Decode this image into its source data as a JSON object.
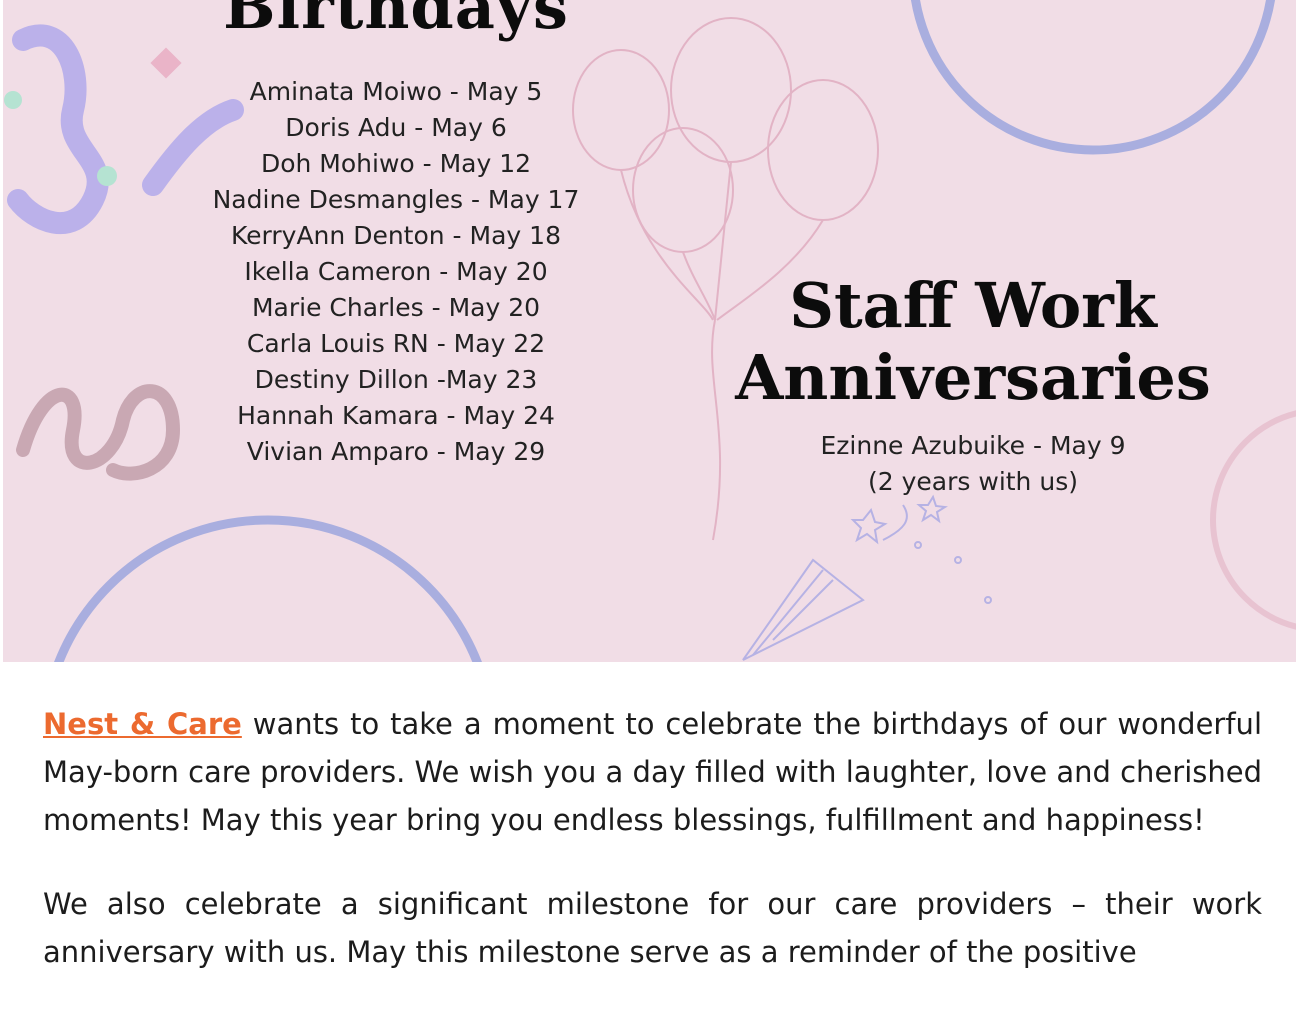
{
  "birthdays": {
    "title": "Birthdays",
    "entries": [
      "Aminata Moiwo - May 5",
      "Doris Adu - May 6",
      "Doh Mohiwo - May 12",
      "Nadine Desmangles - May 17",
      "KerryAnn Denton - May 18",
      "Ikella Cameron - May 20",
      "Marie Charles - May 20",
      "Carla Louis RN - May 22",
      "Destiny Dillon -May 23",
      "Hannah Kamara - May 24",
      "Vivian Amparo - May 29"
    ]
  },
  "anniversaries": {
    "title_line1": "Staff Work",
    "title_line2": "Anniversaries",
    "entry_line1": "Ezinne Azubuike - May 9",
    "entry_line2": "(2 years with us)"
  },
  "body": {
    "brand_link": "Nest & Care",
    "paragraph1_rest": " wants to take a moment to celebrate the birthdays of our wonderful May-born care providers.  We wish you a day filled with laughter, love and cherished moments! May this year bring you endless blessings, fulfillment and happiness!",
    "paragraph2": "We also celebrate a significant milestone for our care providers – their work anniversary with us.  May this milestone serve as a reminder of the positive"
  },
  "colors": {
    "banner_bg": "#f1dde6",
    "brand_orange": "#ec6a2f",
    "ring_blue": "#a9aedf",
    "ribbon_purple": "#bbb1ea",
    "ribbon_pink": "#e5b6c8"
  }
}
